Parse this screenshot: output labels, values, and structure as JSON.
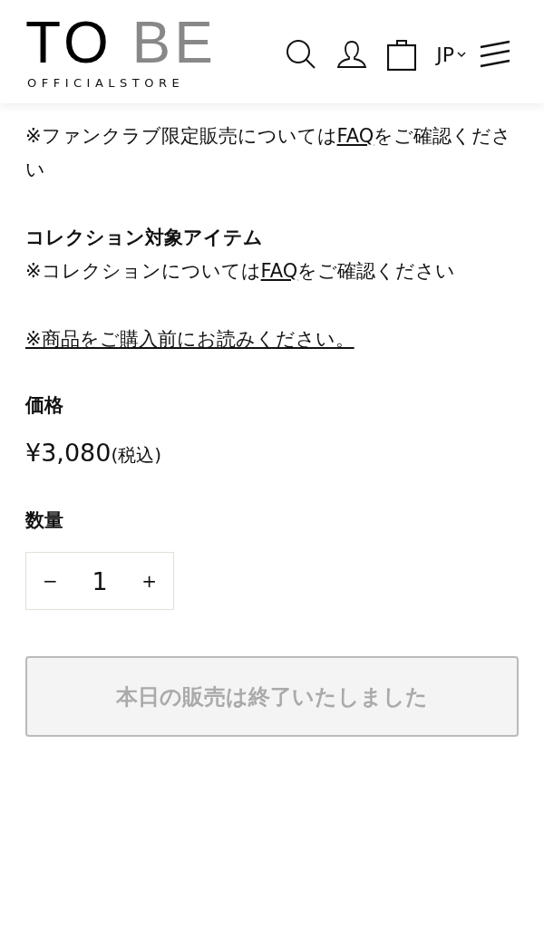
{
  "header": {
    "logo": "TO BE",
    "logo_sub": "OFFICIALSTORE",
    "language": "JP"
  },
  "fanclub_note": {
    "before": "※ファンクラブ限定販売については",
    "link": "FAQ",
    "after": "をご確認ください"
  },
  "collection": {
    "title": "コレクション対象アイテム",
    "before": "※コレクションについては",
    "link": "FAQ",
    "after": "をご確認ください"
  },
  "notice_link": "※商品をご購入前にお読みください。",
  "price": {
    "label": "価格",
    "amount": "¥3,080",
    "tax": "(税込)"
  },
  "quantity": {
    "label": "数量",
    "minus": "−",
    "value": "1",
    "plus": "+"
  },
  "buy_button": {
    "label": "本日の販売は終了いたしました",
    "disabled": true
  }
}
